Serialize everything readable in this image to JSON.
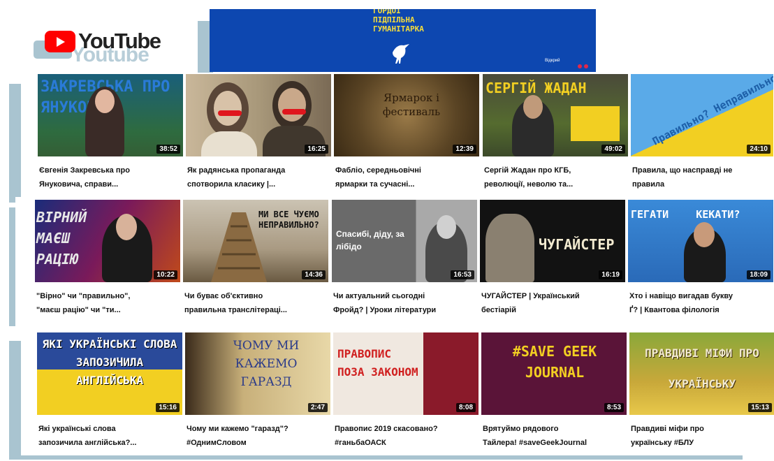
{
  "logo": {
    "text": "YouTube",
    "ghost_text": "Youtube"
  },
  "banner": {
    "line1": "Гордої",
    "line2": "Підпільна",
    "line3": "Гуманітарка",
    "link_label": "Відкрий",
    "bg": "#0d47b0",
    "accent": "#f4dc3c"
  },
  "videos": [
    {
      "title_line1": "Євгенія Закревська про",
      "title_line2": "Януковича, справи...",
      "duration": "38:52",
      "thumb_text": "ЗАКРЕВСЬКА ПРО ЯНУКОВ"
    },
    {
      "title_line1": "Як радянська пропаганда",
      "title_line2": "спотворила класику |...",
      "duration": "16:25",
      "thumb_text": ""
    },
    {
      "title_line1": "Фабліо, середньовічні",
      "title_line2": "ярмарки та сучасні...",
      "duration": "12:39",
      "thumb_text": "Ярмарок і фестиваль"
    },
    {
      "title_line1": "Сергій Жадан про КГБ,",
      "title_line2": "революції, неволю та...",
      "duration": "49:02",
      "thumb_text": "СЕРГІЙ ЖАДАН"
    },
    {
      "title_line1": "Правила, що насправді не",
      "title_line2": "правила",
      "duration": "24:10",
      "thumb_text": "Правильно? Неправильно?"
    },
    {
      "title_line1": "\"Вірно\" чи \"правильно\",",
      "title_line2": "\"маєш рацію\" чи \"ти...",
      "duration": "10:22",
      "thumb_text": "ВІРНИЙ МАЄШ РАЦІЮ"
    },
    {
      "title_line1": "Чи буває об'єктивно",
      "title_line2": "правильна транслітераці...",
      "duration": "14:36",
      "thumb_text": "МИ ВСЕ ЧУЄМО НЕПРАВИЛЬНО?"
    },
    {
      "title_line1": "Чи актуальний сьогодні",
      "title_line2": "Фройд? | Уроки літератури",
      "duration": "16:53",
      "thumb_text": "Спасибі, діду, за лібідо"
    },
    {
      "title_line1": "ЧУГАЙСТЕР | Український",
      "title_line2": "бестіарій",
      "duration": "16:19",
      "thumb_text": "ЧУГАЙСТЕР"
    },
    {
      "title_line1": "Хто і навіщо вигадав букву",
      "title_line2": "Ґ? | Квантова філологія",
      "duration": "18:09",
      "thumb_text": "ГЕГАТИ КЕКАТИ?"
    },
    {
      "title_line1": "Які українські слова",
      "title_line2": "запозичила англійська?...",
      "duration": "15:16",
      "thumb_text": "ЯКІ УКРАЇНСЬКІ СЛОВА ЗАПОЗИЧИЛА АНГЛІЙСЬКА"
    },
    {
      "title_line1": "Чому ми кажемо \"гаразд\"?",
      "title_line2": "#ОднимСловом",
      "duration": "2:47",
      "thumb_text": "ЧОМУ МИ КАЖЕМО ГАРАЗД"
    },
    {
      "title_line1": "Правопис 2019 скасовано?",
      "title_line2": "#ганьбаОАСК",
      "duration": "8:08",
      "thumb_text": "ПРАВОПИС ПОЗА ЗАКОНОМ"
    },
    {
      "title_line1": "Врятуймо рядового",
      "title_line2": "Тайлера! #saveGeekJournal",
      "duration": "8:53",
      "thumb_text": "#SAVE GEEK JOURNAL"
    },
    {
      "title_line1": "Правдиві міфи про",
      "title_line2": "українську #БЛУ",
      "duration": "15:13",
      "thumb_text": "ПРАВДИВІ МІФИ ПРО УКРАЇНСЬКУ"
    }
  ]
}
